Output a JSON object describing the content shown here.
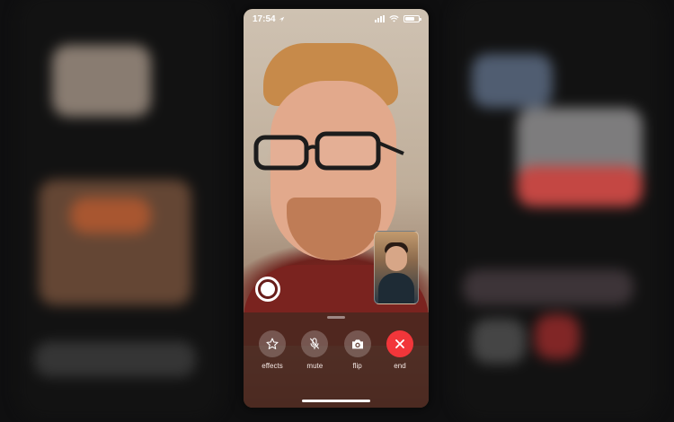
{
  "status_bar": {
    "time": "17:54"
  },
  "controls": [
    {
      "id": "effects",
      "label": "effects",
      "icon": "star-icon"
    },
    {
      "id": "mute",
      "label": "mute",
      "icon": "mic-slash-icon"
    },
    {
      "id": "flip",
      "label": "flip",
      "icon": "camera-icon"
    },
    {
      "id": "end",
      "label": "end",
      "icon": "close-icon",
      "color": "#f2363a"
    }
  ],
  "colors": {
    "end_button": "#f2363a",
    "controls_panel": "#4a2820"
  }
}
